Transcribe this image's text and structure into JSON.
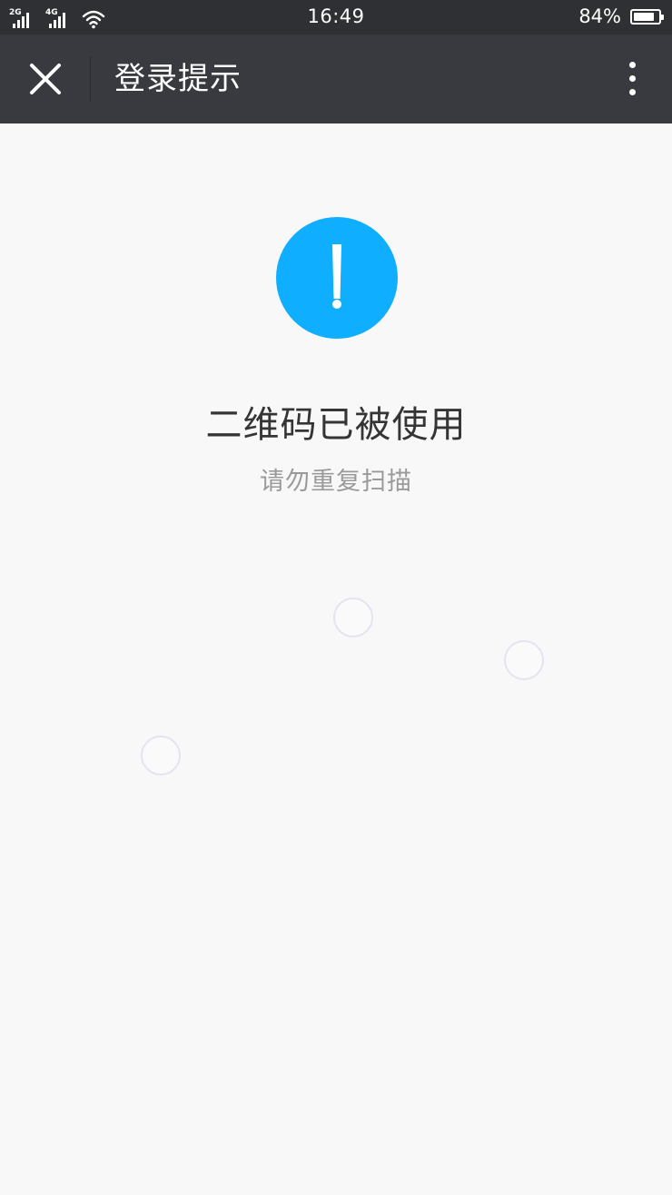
{
  "status_bar": {
    "network_1": "2G",
    "network_2": "4G",
    "time": "16:49",
    "battery_percent": "84%",
    "battery_level": 0.84
  },
  "toolbar": {
    "close_icon": "close-icon",
    "title": "登录提示",
    "more_icon": "more-vertical-icon"
  },
  "content": {
    "icon": "warning-exclamation-icon",
    "icon_color": "#10aeff",
    "title": "二维码已被使用",
    "subtitle": "请勿重复扫描"
  },
  "colors": {
    "status_bar_bg": "#2f3034",
    "toolbar_bg": "#393a3f",
    "page_bg": "#f8f8f8",
    "title_text": "#353535",
    "subtitle_text": "#9a9a9a",
    "bubble_outline": "#e4e4f0"
  }
}
